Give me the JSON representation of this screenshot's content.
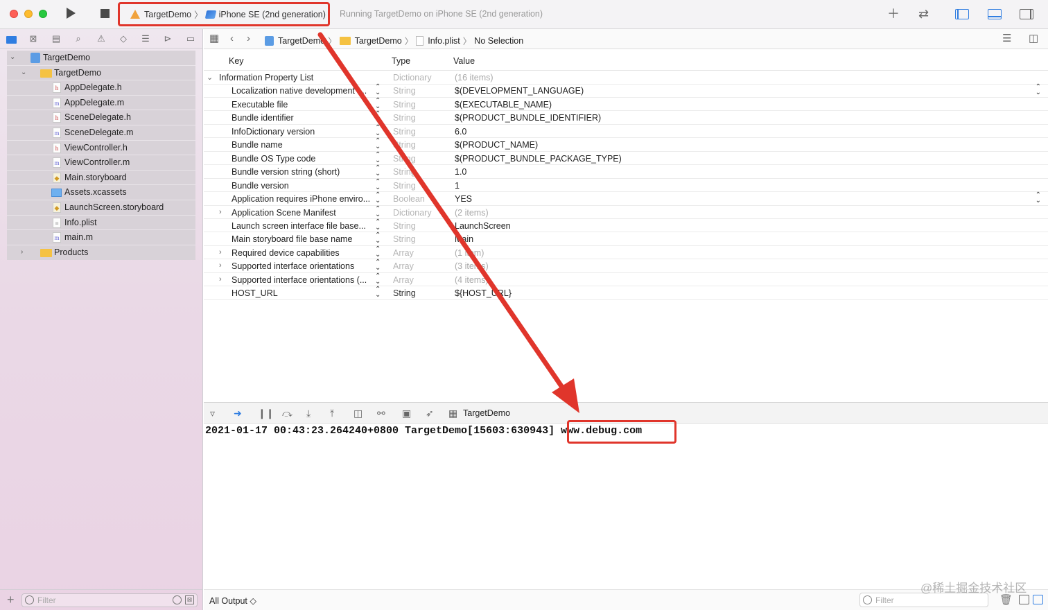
{
  "toolbar": {
    "scheme_app": "TargetDemo",
    "scheme_device": "iPhone SE (2nd generation)",
    "status": "Running TargetDemo on iPhone SE (2nd generation)",
    "add_icon": "plus-icon",
    "swap_icon": "swap-arrows-icon"
  },
  "navigator": {
    "tree": [
      {
        "label": "TargetDemo",
        "kind": "project",
        "level": 0
      },
      {
        "label": "TargetDemo",
        "kind": "folder",
        "level": 1
      },
      {
        "label": "AppDelegate.h",
        "kind": "h",
        "level": 2
      },
      {
        "label": "AppDelegate.m",
        "kind": "m",
        "level": 2
      },
      {
        "label": "SceneDelegate.h",
        "kind": "h",
        "level": 2
      },
      {
        "label": "SceneDelegate.m",
        "kind": "m",
        "level": 2
      },
      {
        "label": "ViewController.h",
        "kind": "h",
        "level": 2
      },
      {
        "label": "ViewController.m",
        "kind": "m",
        "level": 2
      },
      {
        "label": "Main.storyboard",
        "kind": "storyboard",
        "level": 2
      },
      {
        "label": "Assets.xcassets",
        "kind": "assets",
        "level": 2
      },
      {
        "label": "LaunchScreen.storyboard",
        "kind": "storyboard",
        "level": 2
      },
      {
        "label": "Info.plist",
        "kind": "plist",
        "level": 2
      },
      {
        "label": "main.m",
        "kind": "m",
        "level": 2
      },
      {
        "label": "Products",
        "kind": "folder",
        "level": 1
      }
    ],
    "filter_placeholder": "Filter"
  },
  "jumpbar": {
    "crumbs": [
      "TargetDemo",
      "TargetDemo",
      "Info.plist",
      "No Selection"
    ]
  },
  "plist": {
    "headers": {
      "key": "Key",
      "type": "Type",
      "value": "Value"
    },
    "rows": [
      {
        "key": "Information Property List",
        "type": "Dictionary",
        "value": "(16 items)"
      },
      {
        "key": "Localization native development r...",
        "type": "String",
        "value": "$(DEVELOPMENT_LANGUAGE)"
      },
      {
        "key": "Executable file",
        "type": "String",
        "value": "$(EXECUTABLE_NAME)"
      },
      {
        "key": "Bundle identifier",
        "type": "String",
        "value": "$(PRODUCT_BUNDLE_IDENTIFIER)"
      },
      {
        "key": "InfoDictionary version",
        "type": "String",
        "value": "6.0"
      },
      {
        "key": "Bundle name",
        "type": "String",
        "value": "$(PRODUCT_NAME)"
      },
      {
        "key": "Bundle OS Type code",
        "type": "String",
        "value": "$(PRODUCT_BUNDLE_PACKAGE_TYPE)"
      },
      {
        "key": "Bundle version string (short)",
        "type": "String",
        "value": "1.0"
      },
      {
        "key": "Bundle version",
        "type": "String",
        "value": "1"
      },
      {
        "key": "Application requires iPhone enviro...",
        "type": "Boolean",
        "value": "YES"
      },
      {
        "key": "Application Scene Manifest",
        "type": "Dictionary",
        "value": "(2 items)"
      },
      {
        "key": "Launch screen interface file base...",
        "type": "String",
        "value": "LaunchScreen"
      },
      {
        "key": "Main storyboard file base name",
        "type": "String",
        "value": "Main"
      },
      {
        "key": "Required device capabilities",
        "type": "Array",
        "value": "(1 item)"
      },
      {
        "key": "Supported interface orientations",
        "type": "Array",
        "value": "(3 items)"
      },
      {
        "key": "Supported interface orientations (...",
        "type": "Array",
        "value": "(4 items)"
      },
      {
        "key": "HOST_URL",
        "type": "String",
        "value": "${HOST_URL}"
      }
    ]
  },
  "debug": {
    "target": "TargetDemo",
    "console_prefix": "2021-01-17 00:43:23.264240+0800 TargetDemo[15603:630943] ",
    "console_value": "www.debug.com",
    "output_selector": "All Output ◇",
    "filter_placeholder": "Filter"
  },
  "watermark": "@稀土掘金技术社区",
  "annotation_color": "#e0352b"
}
